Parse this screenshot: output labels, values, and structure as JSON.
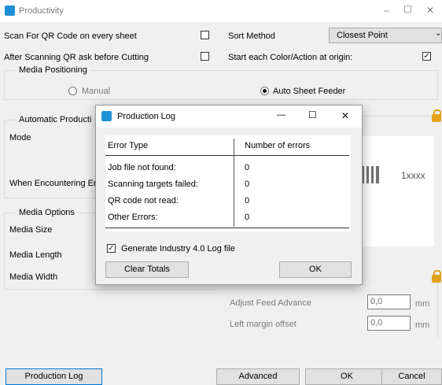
{
  "window": {
    "title": "Productivity",
    "controls": {
      "minimize": "–",
      "maximize": "☐",
      "close": "✕"
    }
  },
  "options": {
    "scan_qr": {
      "label": "Scan For QR Code on every sheet",
      "checked": false
    },
    "ask_before_cut": {
      "label": "After Scanning QR ask before Cutting",
      "checked": false
    },
    "sort_method": {
      "label": "Sort Method",
      "value": "Closest Point"
    },
    "start_origin": {
      "label": "Start each Color/Action at origin:",
      "checked": true,
      "check_glyph": "✓"
    }
  },
  "media_positioning": {
    "legend": "Media Positioning",
    "manual": "Manual",
    "auto": "Auto Sheet Feeder",
    "selected": "auto"
  },
  "automatic_production": {
    "legend": "Automatic Producti",
    "mode_label": "Mode",
    "when_label": "When Encountering Er"
  },
  "media_options": {
    "legend": "Media Options",
    "size_label": "Media Size",
    "length_label": "Media Length",
    "width_label": "Media Width"
  },
  "qr_preview": {
    "text": "1xxxx"
  },
  "feed": {
    "adjust_label": "Adjust Feed Advance",
    "adjust_value": "0,0",
    "margin_label": "Left margin offset",
    "margin_value": "0,0",
    "unit": "mm"
  },
  "buttons": {
    "production_log": "Production Log",
    "advanced": "Advanced",
    "ok": "OK",
    "cancel": "Cancel"
  },
  "dialog": {
    "title": "Production Log",
    "controls": {
      "minimize": "—",
      "maximize": "☐",
      "close": "✕"
    },
    "header": {
      "col1": "Error Type",
      "col2": "Number of errors"
    },
    "rows": [
      {
        "label": "Job file not found:",
        "value": "0"
      },
      {
        "label": "Scanning targets failed:",
        "value": "0"
      },
      {
        "label": "QR code not read:",
        "value": "0"
      },
      {
        "label": "Other Errors:",
        "value": "0"
      }
    ],
    "generate_log": {
      "label": "Generate Industry 4.0 Log file",
      "checked": true,
      "check_glyph": "✓"
    },
    "clear_button": "Clear Totals",
    "ok_button": "OK"
  },
  "colors": {
    "accent": "#0078d7",
    "app_icon": "#1e90d6",
    "lock": "#e3a21a"
  }
}
